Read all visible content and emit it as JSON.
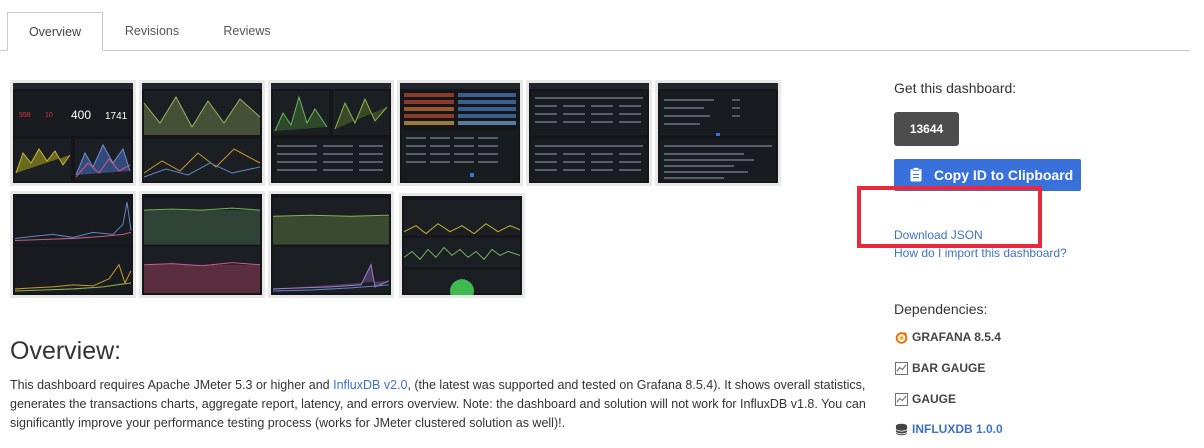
{
  "tabs": [
    {
      "label": "Overview",
      "active": true
    },
    {
      "label": "Revisions",
      "active": false
    },
    {
      "label": "Reviews",
      "active": false
    }
  ],
  "thumbnail_stats": {
    "stat1": "958",
    "stat2": "10",
    "stat3": "400",
    "stat4": "1741"
  },
  "overview": {
    "heading": "Overview:",
    "text_before_link": "This dashboard requires Apache JMeter 5.3 or higher and ",
    "link": "InfluxDB v2.0",
    "text_after_link": ", (the latest was supported and tested on Grafana 8.5.4). It shows overall statistics, generates the transactions charts, aggregate report, latency, and errors overview. Note: the dashboard and solution will not work for InfluxDB v1.8. You can significantly improve your performance testing process (works for JMeter clustered solution as well)!."
  },
  "sidebar": {
    "get_title": "Get this dashboard:",
    "dashboard_id": "13644",
    "copy_button": "Copy ID to Clipboard",
    "download_link": "Download JSON",
    "howto_link": "How do I import this dashboard?",
    "dependencies_title": "Dependencies:",
    "dependencies": [
      {
        "name": "GRAFANA 8.5.4",
        "icon": "grafana-icon"
      },
      {
        "name": "BAR GAUGE",
        "icon": "panel-icon"
      },
      {
        "name": "GAUGE",
        "icon": "panel-icon"
      },
      {
        "name": "INFLUXDB 1.0.0",
        "icon": "database-icon"
      }
    ]
  },
  "colors": {
    "accent": "#3871dc",
    "link": "#3f72c4",
    "highlight": "#e8283c",
    "id_box": "#4d4d4d"
  }
}
